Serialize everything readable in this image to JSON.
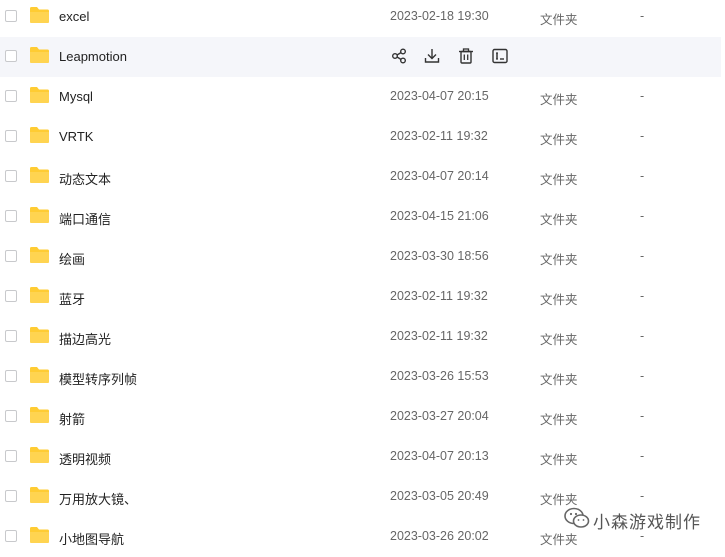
{
  "colors": {
    "folder": "#ffcc33",
    "hover_row": "#f5f6fa",
    "text_primary": "#222222",
    "text_secondary": "#666666"
  },
  "files": [
    {
      "name": "excel",
      "modified": "2023-02-18 19:30",
      "type": "文件夹",
      "size": "-"
    },
    {
      "name": "Leapmotion",
      "modified": "",
      "type": "",
      "size": "",
      "hovered": true
    },
    {
      "name": "Mysql",
      "modified": "2023-04-07 20:15",
      "type": "文件夹",
      "size": "-"
    },
    {
      "name": "VRTK",
      "modified": "2023-02-11 19:32",
      "type": "文件夹",
      "size": "-"
    },
    {
      "name": "动态文本",
      "modified": "2023-04-07 20:14",
      "type": "文件夹",
      "size": "-"
    },
    {
      "name": "端口通信",
      "modified": "2023-04-15 21:06",
      "type": "文件夹",
      "size": "-"
    },
    {
      "name": "绘画",
      "modified": "2023-03-30 18:56",
      "type": "文件夹",
      "size": "-"
    },
    {
      "name": "蓝牙",
      "modified": "2023-02-11 19:32",
      "type": "文件夹",
      "size": "-"
    },
    {
      "name": "描边高光",
      "modified": "2023-02-11 19:32",
      "type": "文件夹",
      "size": "-"
    },
    {
      "name": "模型转序列帧",
      "modified": "2023-03-26 15:53",
      "type": "文件夹",
      "size": "-"
    },
    {
      "name": "射箭",
      "modified": "2023-03-27 20:04",
      "type": "文件夹",
      "size": "-"
    },
    {
      "name": "透明视频",
      "modified": "2023-04-07 20:13",
      "type": "文件夹",
      "size": "-"
    },
    {
      "name": "万用放大镜、",
      "modified": "2023-03-05 20:49",
      "type": "文件夹",
      "size": "-"
    },
    {
      "name": "小地图导航",
      "modified": "2023-03-26 20:02",
      "type": "文件夹",
      "size": "-"
    }
  ],
  "row_actions": [
    "share-icon",
    "download-icon",
    "delete-icon",
    "rename-icon"
  ],
  "watermark": {
    "text": "小森游戏制作",
    "icon": "wechat-logo-icon"
  }
}
